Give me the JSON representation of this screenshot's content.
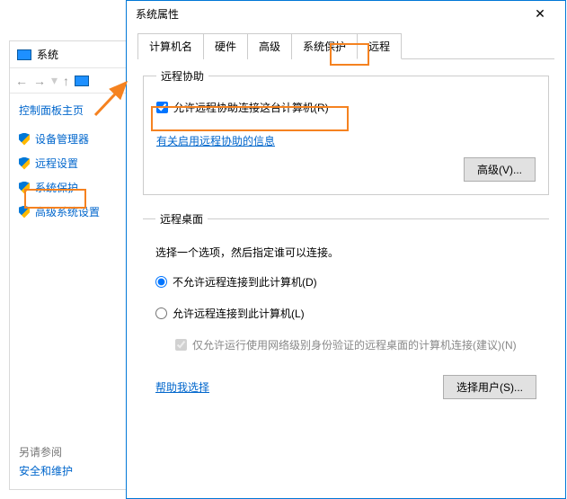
{
  "bgWindow": {
    "title": "系统",
    "controlPanelHome": "控制面板主页",
    "items": [
      "设备管理器",
      "远程设置",
      "系统保护",
      "高级系统设置"
    ],
    "seeAlsoLabel": "另请参阅",
    "seeAlsoItem": "安全和维护"
  },
  "dialog": {
    "title": "系统属性",
    "tabs": [
      "计算机名",
      "硬件",
      "高级",
      "系统保护",
      "远程"
    ],
    "activeTab": 4,
    "remoteAssist": {
      "legend": "远程协助",
      "checkboxLabel": "允许远程协助连接这台计算机(R)",
      "infoLink": "有关启用远程协助的信息",
      "advancedBtn": "高级(V)..."
    },
    "remoteDesktop": {
      "legend": "远程桌面",
      "desc": "选择一个选项，然后指定谁可以连接。",
      "radio1": "不允许远程连接到此计算机(D)",
      "radio2": "允许远程连接到此计算机(L)",
      "subCheck": "仅允许运行使用网络级别身份验证的远程桌面的计算机连接(建议)(N)",
      "helpLink": "帮助我选择",
      "selectUsersBtn": "选择用户(S)..."
    }
  }
}
